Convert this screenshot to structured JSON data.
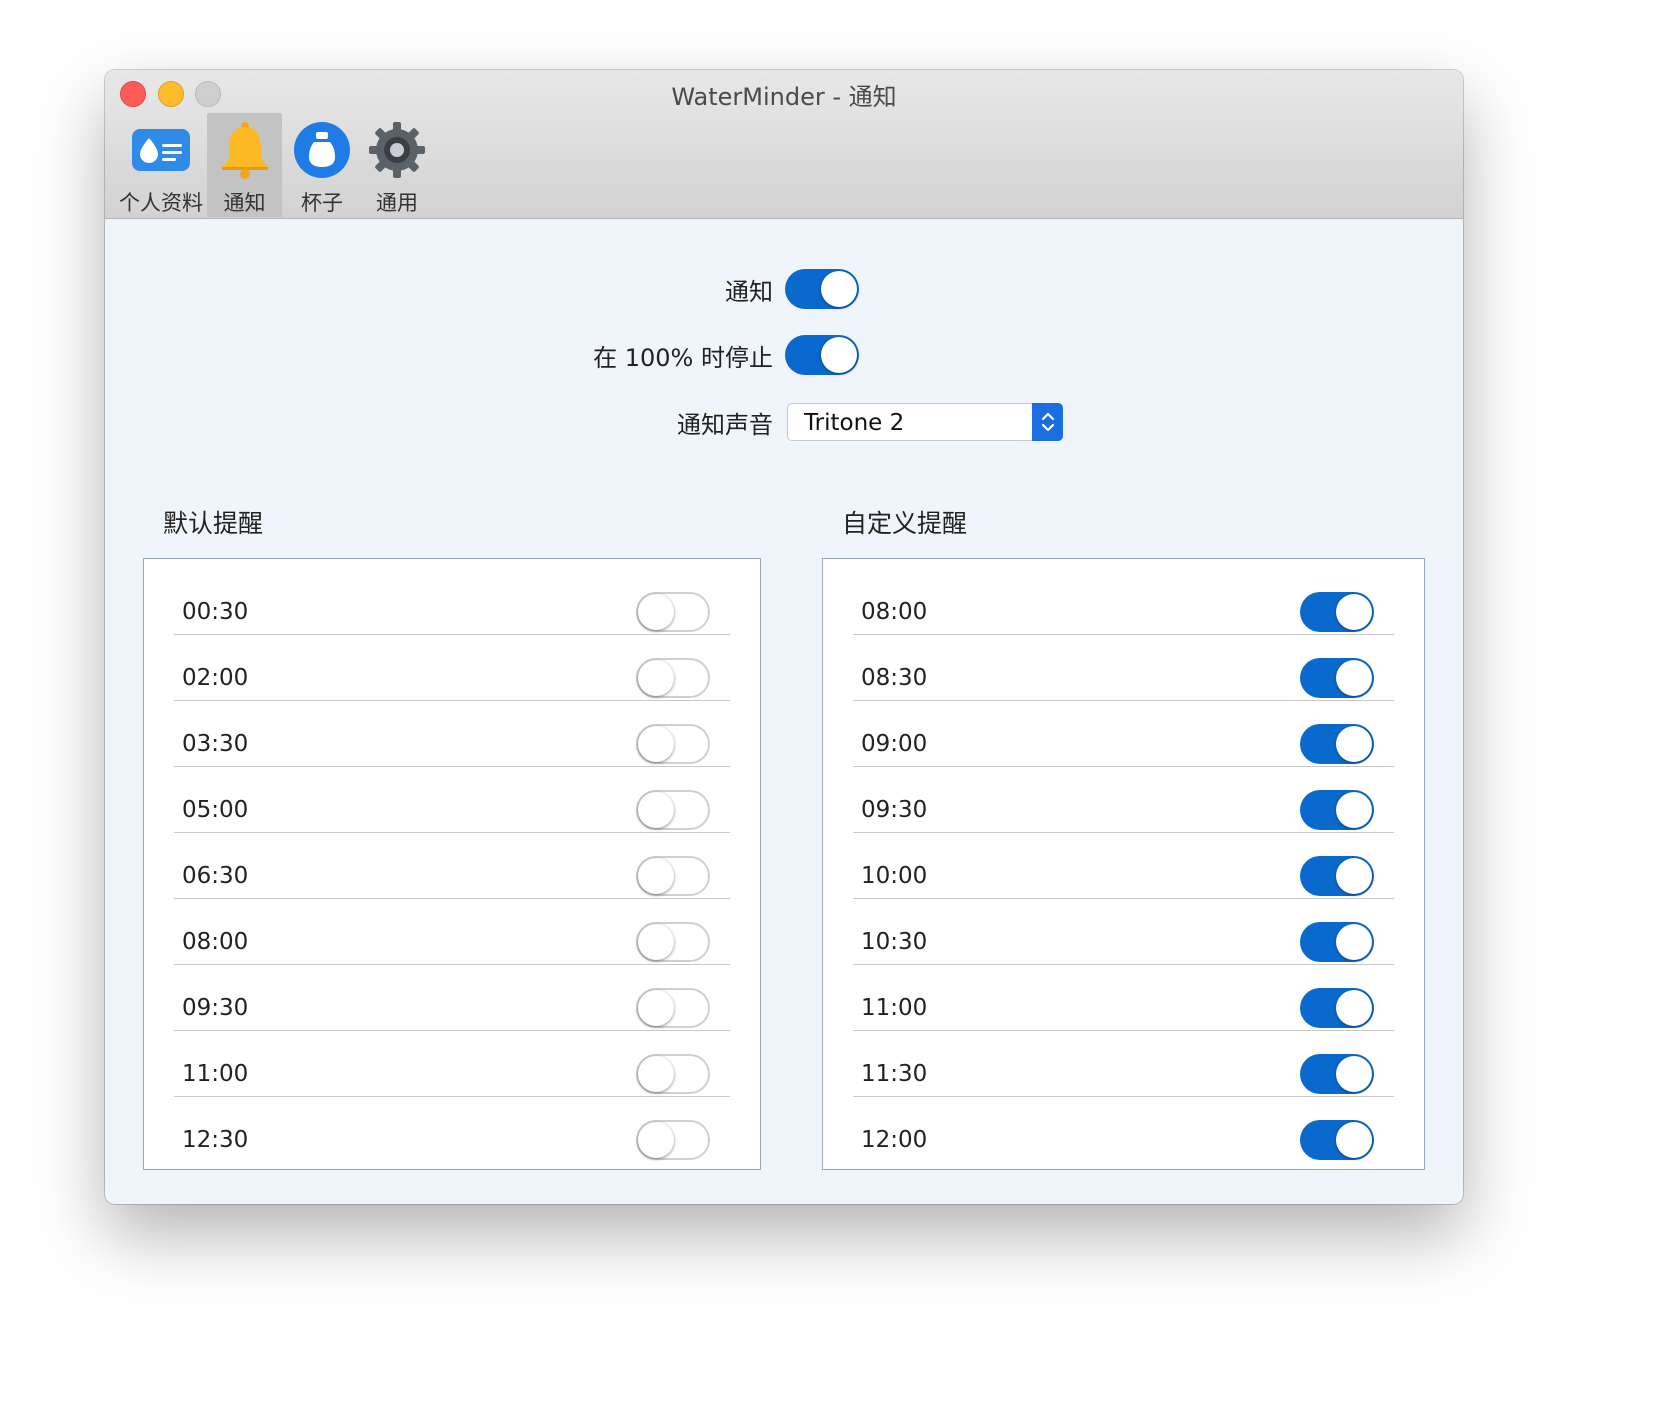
{
  "window": {
    "title": "WaterMinder - 通知"
  },
  "toolbar": {
    "tabs": [
      {
        "label": "个人资料",
        "icon": "profile-card-icon",
        "active": false
      },
      {
        "label": "通知",
        "icon": "bell-icon",
        "active": true
      },
      {
        "label": "杯子",
        "icon": "cup-icon",
        "active": false
      },
      {
        "label": "通用",
        "icon": "gear-icon",
        "active": false
      }
    ]
  },
  "settings": {
    "notifications_label": "通知",
    "notifications_on": true,
    "stop_at_100_label": "在 100% 时停止",
    "stop_at_100_on": true,
    "sound_label": "通知声音",
    "sound_value": "Tritone 2"
  },
  "default_reminders": {
    "title": "默认提醒",
    "items": [
      {
        "time": "00:30",
        "on": false
      },
      {
        "time": "02:00",
        "on": false
      },
      {
        "time": "03:30",
        "on": false
      },
      {
        "time": "05:00",
        "on": false
      },
      {
        "time": "06:30",
        "on": false
      },
      {
        "time": "08:00",
        "on": false
      },
      {
        "time": "09:30",
        "on": false
      },
      {
        "time": "11:00",
        "on": false
      },
      {
        "time": "12:30",
        "on": false
      }
    ]
  },
  "custom_reminders": {
    "title": "自定义提醒",
    "items": [
      {
        "time": "08:00",
        "on": true
      },
      {
        "time": "08:30",
        "on": true
      },
      {
        "time": "09:00",
        "on": true
      },
      {
        "time": "09:30",
        "on": true
      },
      {
        "time": "10:00",
        "on": true
      },
      {
        "time": "10:30",
        "on": true
      },
      {
        "time": "11:00",
        "on": true
      },
      {
        "time": "11:30",
        "on": true
      },
      {
        "time": "12:00",
        "on": true
      }
    ]
  },
  "colors": {
    "accent": "#0a69cc",
    "background": "#f0f5fc"
  }
}
